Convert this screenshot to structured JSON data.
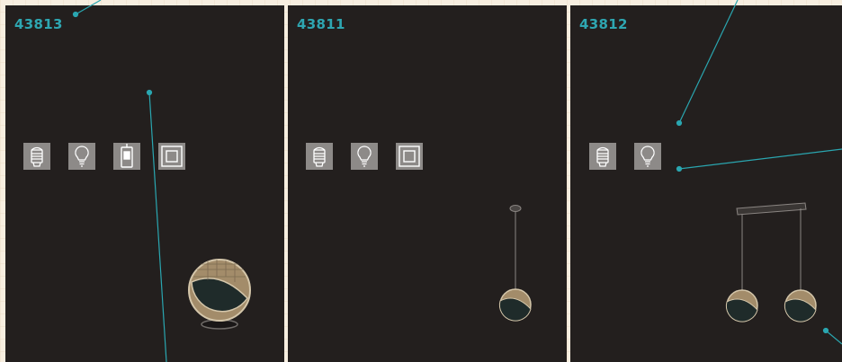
{
  "panels": [
    {
      "code": "43813",
      "icons": [
        "e27-bulb-base-icon",
        "light-bulb-icon",
        "switch-icon",
        "square-frame-icon"
      ],
      "product": "round-table-lamp"
    },
    {
      "code": "43811",
      "icons": [
        "e27-bulb-base-icon",
        "light-bulb-icon",
        "square-frame-icon"
      ],
      "product": "single-pendant-lamp"
    },
    {
      "code": "43812",
      "icons": [
        "e27-bulb-base-icon",
        "light-bulb-icon"
      ],
      "product": "double-pendant-lamp"
    }
  ],
  "colors": {
    "panel": "#231f1e",
    "accent": "#2ea6b1",
    "icon_tile": "#8d8a88",
    "background": "#f7eee0"
  }
}
